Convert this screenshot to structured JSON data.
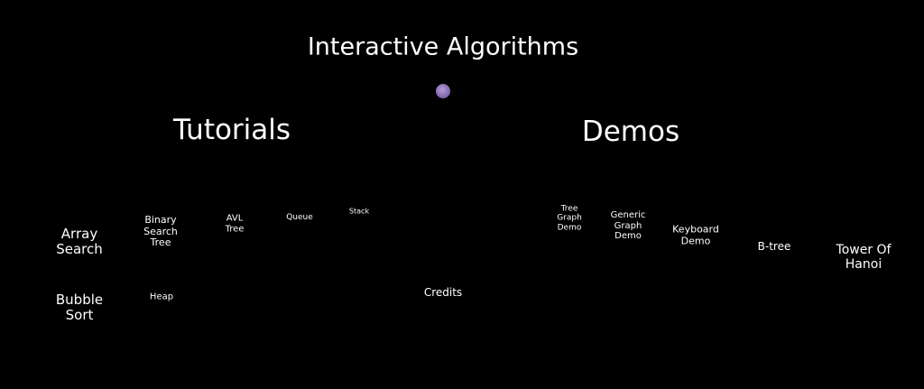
{
  "title": "Interactive Algorithms",
  "tutorials": {
    "heading": "Tutorials",
    "items": [
      "Array\nSearch",
      "Binary\nSearch\nTree",
      "AVL\nTree",
      "Queue",
      "Stack",
      "Bubble\nSort",
      "Heap"
    ]
  },
  "demos": {
    "heading": "Demos",
    "items": [
      "Tree\nGraph\nDemo",
      "Generic\nGraph\nDemo",
      "Keyboard\nDemo",
      "B-tree",
      "Tower Of\nHanoi"
    ]
  },
  "credits": "Credits",
  "colors": {
    "background": "#000000",
    "orb": "#9b82c4",
    "text": "#ffffff"
  }
}
